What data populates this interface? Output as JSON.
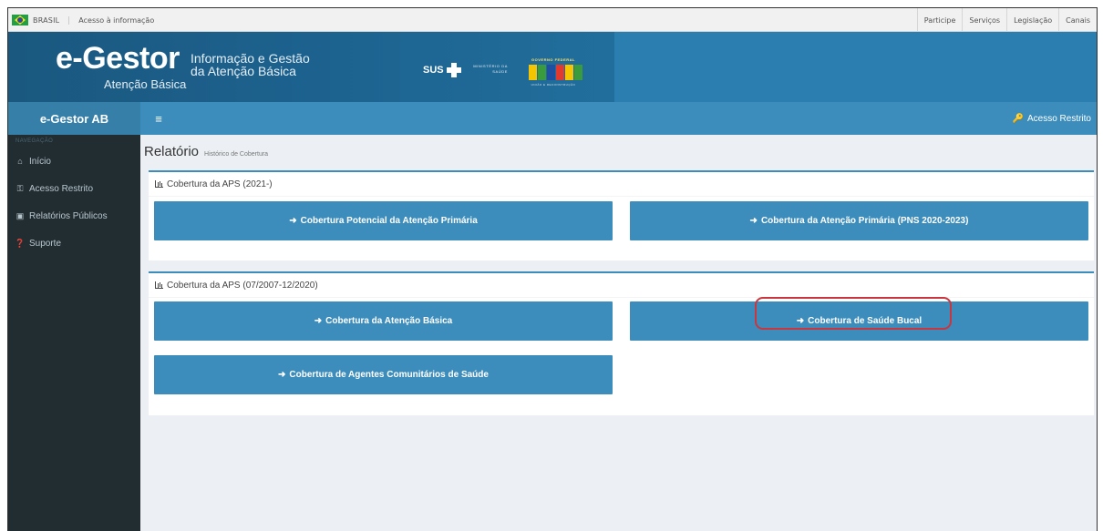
{
  "govbar": {
    "country": "BRASIL",
    "access_info": "Acesso à informação",
    "links": [
      "Participe",
      "Serviços",
      "Legislação",
      "Canais"
    ]
  },
  "banner": {
    "logo_main": "e-Gestor",
    "logo_sub": "Atenção Básica",
    "desc_line1": "Informação e Gestão",
    "desc_line2": "da Atenção Básica",
    "sus_text": "SUS",
    "ministry_line1": "MINISTÉRIO DA",
    "ministry_line2": "SAÚDE",
    "gov_top": "GOVERNO FEDERAL",
    "gov_bottom": "UNIÃO E RECONSTRUÇÃO"
  },
  "nav": {
    "brand": "e-Gestor AB",
    "menu_icon": "≡",
    "restricted": "Acesso Restrito"
  },
  "sidebar": {
    "heading": "NAVEGAÇÃO",
    "items": [
      {
        "label": "Início",
        "icon": "home-icon"
      },
      {
        "label": "Acesso Restrito",
        "icon": "key-icon"
      },
      {
        "label": "Relatórios Públicos",
        "icon": "monitor-icon"
      },
      {
        "label": "Suporte",
        "icon": "question-circle-icon"
      }
    ]
  },
  "content": {
    "title": "Relatório",
    "subtitle": "Histórico de Cobertura",
    "sections": [
      {
        "heading": "Cobertura da APS (2021-)",
        "buttons": [
          "Cobertura Potencial da Atenção Primária",
          "Cobertura da Atenção Primária (PNS 2020-2023)"
        ]
      },
      {
        "heading": "Cobertura da APS (07/2007-12/2020)",
        "buttons": [
          "Cobertura da Atenção Básica",
          "Cobertura de Saúde Bucal",
          "Cobertura de Agentes Comunitários de Saúde"
        ]
      }
    ]
  },
  "colors": {
    "primary": "#3c8dbc",
    "sidebar": "#222d32",
    "highlight": "#c9363e"
  }
}
